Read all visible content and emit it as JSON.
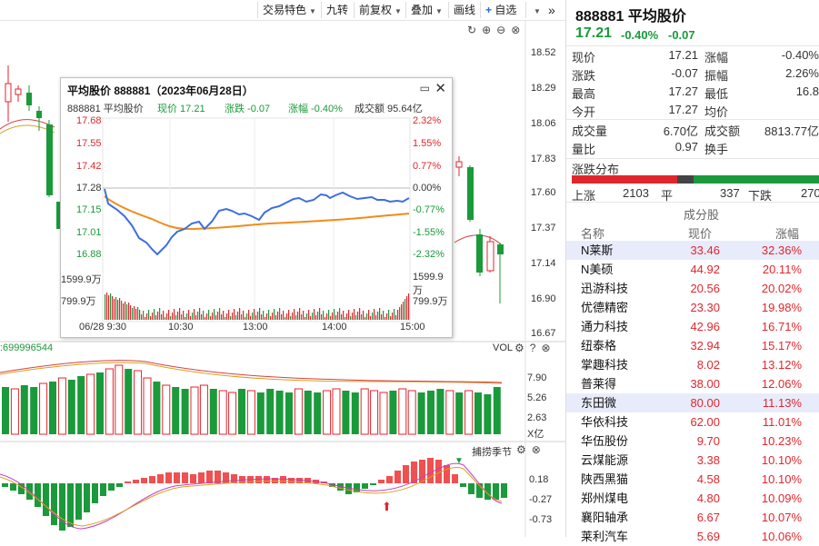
{
  "toolbar": {
    "items": [
      "交易特色",
      "九转",
      "前复权",
      "叠加",
      "画线",
      "自选"
    ],
    "add_icon": "plus-icon",
    "expand": "»"
  },
  "main_axis": [
    "18.52",
    "18.29",
    "18.06",
    "17.83",
    "17.60",
    "17.37",
    "17.14",
    "16.90",
    "16.67"
  ],
  "vol_panel": {
    "left_label": ":699996544",
    "title": "VOL",
    "axis": [
      "7.90",
      "5.26",
      "2.63",
      "X亿"
    ]
  },
  "macd_panel": {
    "title": "捕捞季节",
    "axis": [
      "0.18",
      "-0.27",
      "-0.73"
    ]
  },
  "popup": {
    "title": "平均股价 888881（2023年06月28日）",
    "name_code": "888881 平均股价",
    "price_label": "现价 17.21",
    "change_label": "涨跌 -0.07",
    "pct_label": "涨幅 -0.40%",
    "amount_label": "成交额 95.64亿",
    "left_axis": [
      "17.68",
      "17.55",
      "17.42",
      "17.28",
      "17.15",
      "17.01",
      "16.88",
      "1599.9万",
      "799.9万"
    ],
    "right_axis": [
      "2.32%",
      "1.55%",
      "0.77%",
      "0.00%",
      "-0.77%",
      "-1.55%",
      "-2.32%",
      "1599.9万",
      "799.9万"
    ],
    "time_axis": [
      "06/28 9:30",
      "10:30",
      "13:00",
      "14:00",
      "15:00"
    ]
  },
  "panel": {
    "code": "888881",
    "name": "平均股价",
    "price": "17.21",
    "change_pct": "-0.40%",
    "change": "-0.07",
    "quotes": [
      {
        "l": "现价",
        "v": "17.21",
        "l2": "涨幅",
        "v2": "-0.40%"
      },
      {
        "l": "涨跌",
        "v": "-0.07",
        "l2": "振幅",
        "v2": "2.26%"
      },
      {
        "l": "最高",
        "v": "17.27",
        "l2": "最低",
        "v2": "16.8"
      },
      {
        "l": "今开",
        "v": "17.27",
        "l2": "均价",
        "v2": ""
      }
    ],
    "volume_rows": [
      {
        "l": "成交量",
        "v": "6.70亿",
        "l2": "成交额",
        "v2": "8813.77亿"
      },
      {
        "l": "量比",
        "v": "0.97",
        "l2": "换手",
        "v2": ""
      }
    ],
    "dist_title": "涨跌分布",
    "dist": {
      "up_label": "上涨",
      "up": "2103",
      "flat_label": "平",
      "flat": "337",
      "down_label": "下跌",
      "down": "270"
    },
    "components_title": "成分股",
    "col_name": "名称",
    "col_price": "现价",
    "col_pct": "涨幅",
    "stocks": [
      {
        "n": "N莱斯",
        "p": "33.46",
        "c": "32.36%",
        "hl": true
      },
      {
        "n": "N美硕",
        "p": "44.92",
        "c": "20.11%"
      },
      {
        "n": "迅游科技",
        "p": "20.56",
        "c": "20.02%"
      },
      {
        "n": "优德精密",
        "p": "23.30",
        "c": "19.98%"
      },
      {
        "n": "通力科技",
        "p": "42.96",
        "c": "16.71%"
      },
      {
        "n": "纽泰格",
        "p": "32.94",
        "c": "15.17%"
      },
      {
        "n": "掌趣科技",
        "p": "8.02",
        "c": "13.12%"
      },
      {
        "n": "普莱得",
        "p": "38.00",
        "c": "12.06%"
      },
      {
        "n": "东田微",
        "p": "80.00",
        "c": "11.13%",
        "hl": true
      },
      {
        "n": "华依科技",
        "p": "62.00",
        "c": "11.01%"
      },
      {
        "n": "华伍股份",
        "p": "9.70",
        "c": "10.23%"
      },
      {
        "n": "云煤能源",
        "p": "3.38",
        "c": "10.10%"
      },
      {
        "n": "陕西黑猫",
        "p": "4.58",
        "c": "10.10%"
      },
      {
        "n": "郑州煤电",
        "p": "4.80",
        "c": "10.09%"
      },
      {
        "n": "襄阳轴承",
        "p": "6.67",
        "c": "10.07%"
      },
      {
        "n": "莱利汽车",
        "p": "5.69",
        "c": "10.06%"
      }
    ]
  },
  "colors": {
    "up": "#e0262d",
    "down": "#1a9a3a",
    "avg": "#f08c1a",
    "price_line": "#3c6fe0"
  }
}
